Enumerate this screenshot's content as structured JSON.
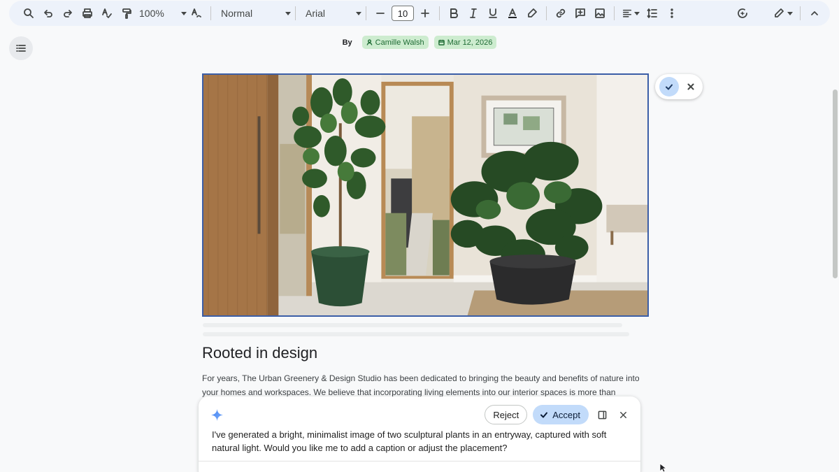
{
  "toolbar": {
    "zoom": "100%",
    "style": "Normal",
    "font": "Arial",
    "font_size": "10"
  },
  "byline": {
    "by_label": "By",
    "author": "Camille Walsh",
    "date": "Mar 12, 2026"
  },
  "document": {
    "heading": "Rooted in design",
    "body": "For years, The Urban Greenery & Design Studio has been dedicated to bringing the beauty and benefits of nature into your homes and workspaces. We believe that incorporating living elements into our interior spaces is more than"
  },
  "gemini_panel": {
    "reject_label": "Reject",
    "accept_label": "Accept",
    "message": "I've generated a bright, minimalist image of two sculptural plants in an entryway, captured with soft natural light. Would you like me to add a caption or adjust the placement?"
  },
  "icons": [
    "search-icon",
    "undo-icon",
    "redo-icon",
    "print-icon",
    "spellcheck-icon",
    "paint-format-icon",
    "clear-format-icon",
    "minus-icon",
    "plus-icon",
    "bold-icon",
    "italic-icon",
    "underline-icon",
    "text-color-icon",
    "highlight-icon",
    "link-icon",
    "comment-icon",
    "image-icon",
    "align-icon",
    "line-spacing-icon",
    "more-icon",
    "gemini-icon",
    "edit-mode-icon",
    "collapse-icon",
    "outline-icon",
    "person-icon",
    "calendar-icon",
    "check-icon",
    "close-icon",
    "sparkle-icon",
    "side-panel-icon"
  ],
  "colors": {
    "toolbar_bg": "#edf2fa",
    "chip_bg": "#cdeccf",
    "accept_bg": "#c2dbfa",
    "image_border": "#3b5ea7"
  }
}
